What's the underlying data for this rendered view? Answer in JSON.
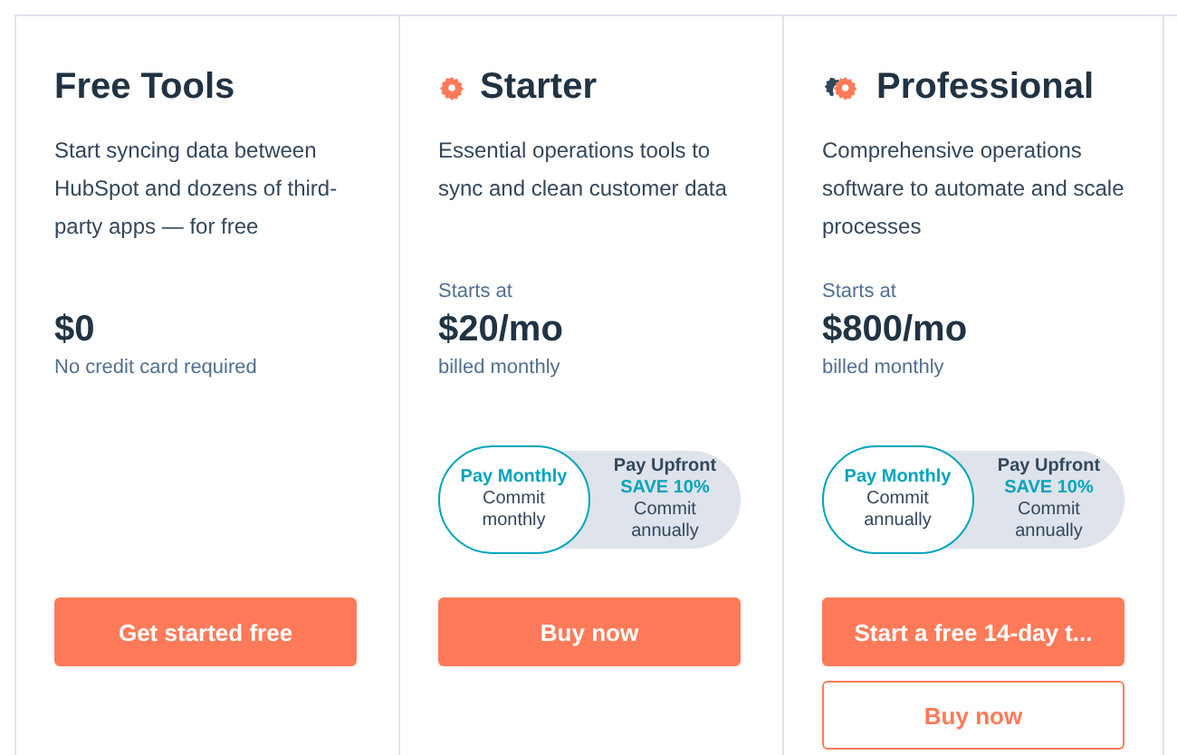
{
  "plans": [
    {
      "name": "Free Tools",
      "kind": "free",
      "description": "Start syncing data between HubSpot and dozens of third-party apps — for free",
      "price": "$0",
      "price_note": "No credit card required",
      "buttons": [
        {
          "label": "Get started free",
          "kind": "primary"
        }
      ]
    },
    {
      "name": "Starter",
      "kind": "starter",
      "description": "Essential operations tools to sync and clean customer data",
      "starts_at": "Starts at",
      "price": "$20/mo",
      "price_note": "billed monthly",
      "billing_toggle": [
        {
          "title": "Pay Monthly",
          "detail": "Commit monthly",
          "selected": true
        },
        {
          "title": "Pay Upfront",
          "save": "SAVE 10%",
          "detail": "Commit annually",
          "selected": false
        }
      ],
      "buttons": [
        {
          "label": "Buy now",
          "kind": "primary"
        }
      ]
    },
    {
      "name": "Professional",
      "kind": "professional",
      "description": "Comprehensive operations software to automate and scale processes",
      "starts_at": "Starts at",
      "price": "$800/mo",
      "price_note": "billed monthly",
      "billing_toggle": [
        {
          "title": "Pay Monthly",
          "detail": "Commit annually",
          "selected": true
        },
        {
          "title": "Pay Upfront",
          "save": "SAVE 10%",
          "detail": "Commit annually",
          "selected": false
        }
      ],
      "buttons": [
        {
          "label": "Start a free 14-day t...",
          "kind": "primary"
        },
        {
          "label": "Buy now",
          "kind": "secondary"
        }
      ]
    }
  ]
}
